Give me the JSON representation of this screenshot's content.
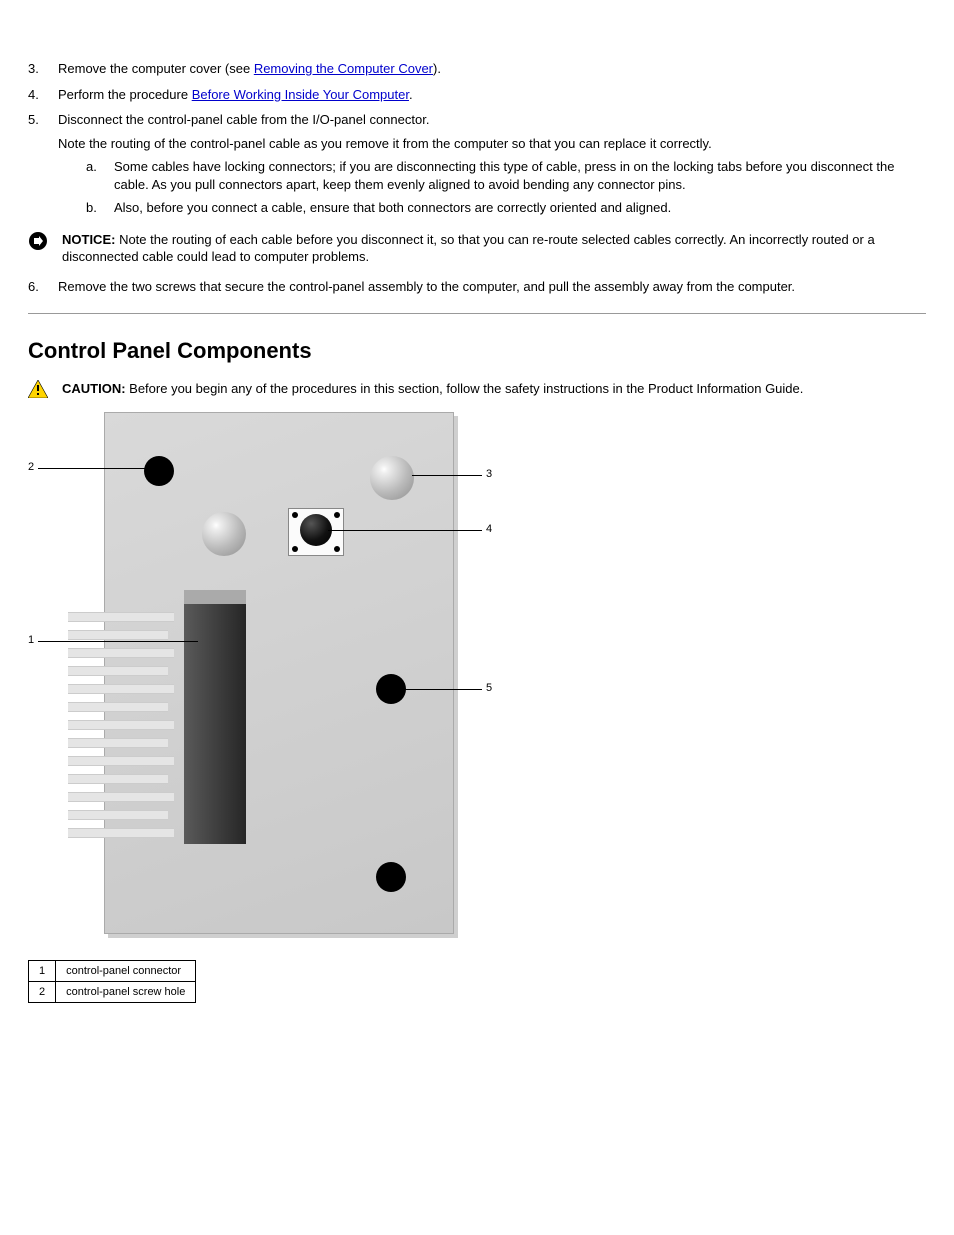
{
  "steps": [
    {
      "num": "3.",
      "text_before": "Remove the computer cover (see ",
      "link": "Removing the Computer Cover",
      "text_after": ")."
    },
    {
      "num": "4.",
      "text_before": "Perform the procedure ",
      "link": "Before Working Inside Your Computer",
      "text_after": "."
    },
    {
      "num": "5.",
      "text_before": "Disconnect the control-panel cable from the I/O-panel connector.",
      "link": "",
      "text_after": ""
    }
  ],
  "substeps_intro": "Note the routing of the control-panel cable as you remove it from the computer so that you can replace it correctly.",
  "substeps": [
    {
      "label": "a.",
      "text": "Some cables have locking connectors; if you are disconnecting this type of cable, press in on the locking tabs before you disconnect the cable. As you pull connectors apart, keep them evenly aligned to avoid bending any connector pins."
    },
    {
      "label": "b.",
      "text": "Also, before you connect a cable, ensure that both connectors are correctly oriented and aligned."
    }
  ],
  "steps2": [
    {
      "num": "6.",
      "text": "Remove the two screws that secure the control-panel assembly to the computer, and pull the assembly away from the computer."
    }
  ],
  "notice_label": "NOTICE:",
  "notice_text": " Note the routing of each cable before you disconnect it, so that you can re-route selected cables correctly. An incorrectly routed or a disconnected cable could lead to computer problems.",
  "section_title": "Control Panel Components",
  "caution_label": "CAUTION:",
  "caution_text": " Before you begin any of the procedures in this section, follow the safety instructions in the Product Information Guide.",
  "callouts": {
    "c1": "1",
    "c2": "2",
    "c3": "3",
    "c4": "4",
    "c5": "5"
  },
  "parts": [
    {
      "num": "1",
      "name": "control-panel connector"
    },
    {
      "num": "2",
      "name": "control-panel screw hole"
    }
  ]
}
